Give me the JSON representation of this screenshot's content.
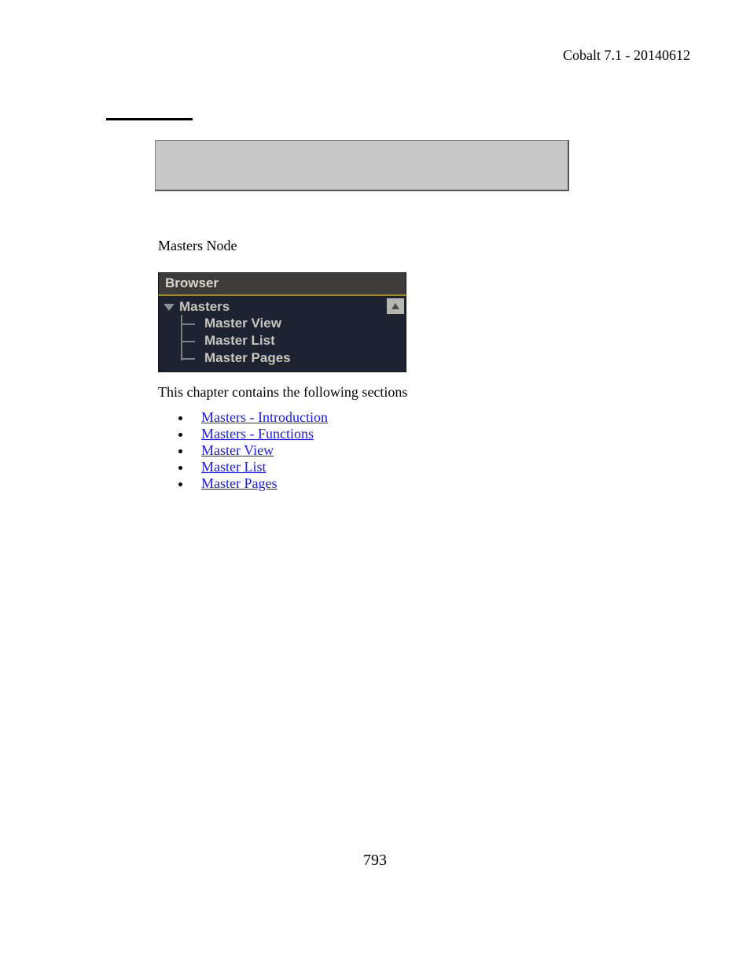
{
  "header": "Cobalt 7.1 - 20140612",
  "caption": "Masters Node",
  "browser": {
    "title": "Browser",
    "root": "Masters",
    "children": [
      "Master View",
      "Master List",
      "Master Pages"
    ]
  },
  "sections_intro": "This chapter contains the following sections",
  "sections": [
    "Masters - Introduction",
    "Masters - Functions",
    "Master View",
    "Master List",
    "Master Pages"
  ],
  "page_number": "793"
}
